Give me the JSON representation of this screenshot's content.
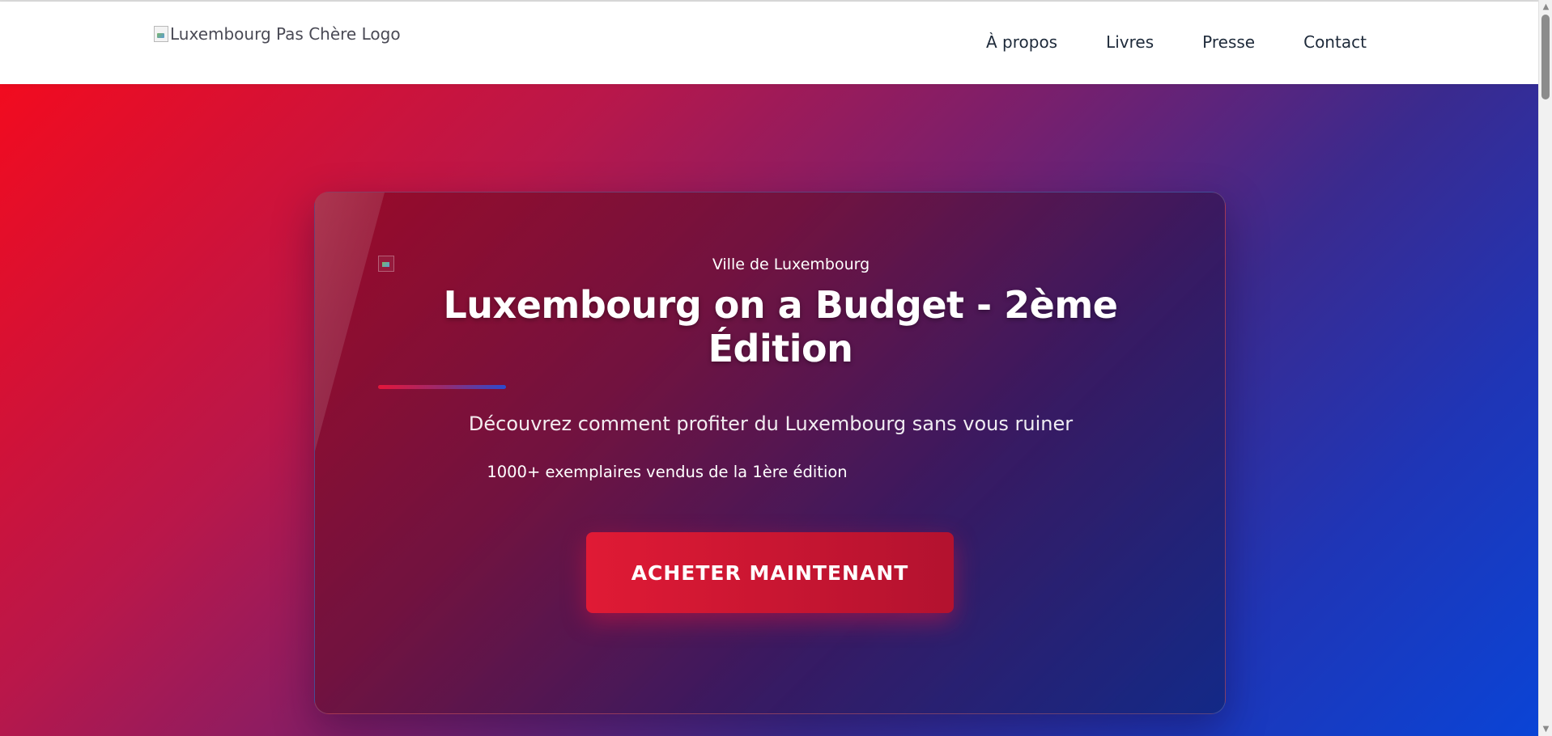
{
  "header": {
    "logo_alt": "Luxembourg Pas Chère Logo",
    "nav": [
      {
        "label": "À propos"
      },
      {
        "label": "Livres"
      },
      {
        "label": "Presse"
      },
      {
        "label": "Contact"
      }
    ]
  },
  "hero": {
    "image_alt": "Ville de Luxembourg",
    "title": "Luxembourg on a Budget - 2ème Édition",
    "subtitle": "Découvrez comment profiter du Luxembourg sans vous ruiner",
    "sales_note": "1000+ exemplaires vendus de la 1ère édition",
    "cta_label": "ACHETER MAINTENANT"
  },
  "scrollbar": {
    "up_icon": "chevron-up-icon",
    "down_icon": "chevron-down-icon"
  },
  "colors": {
    "hero_gradient_start": "#f20b1f",
    "hero_gradient_end": "#0a44d6",
    "cta": "#e01a35",
    "nav_text": "#1e2a3a"
  }
}
